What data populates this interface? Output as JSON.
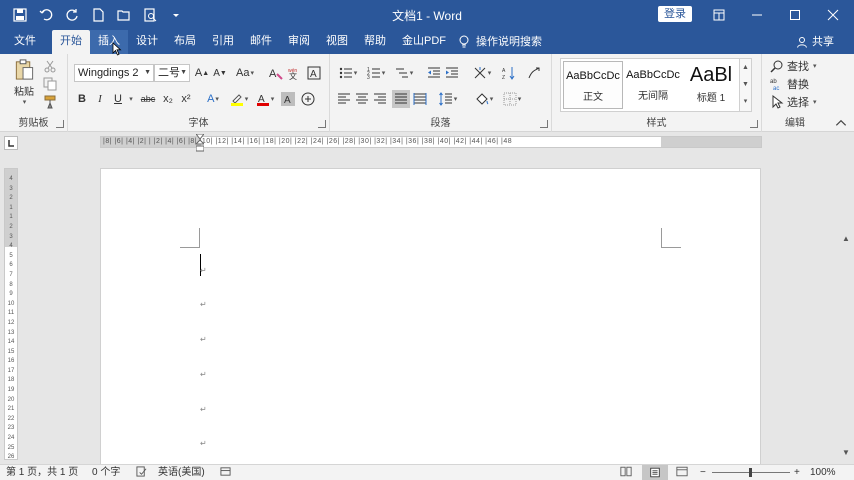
{
  "window": {
    "title": "文档1 - Word",
    "login_label": "登录"
  },
  "tabs": [
    {
      "label": "文件",
      "state": "normal"
    },
    {
      "label": "开始",
      "state": "active"
    },
    {
      "label": "插入",
      "state": "hover"
    },
    {
      "label": "设计",
      "state": "normal"
    },
    {
      "label": "布局",
      "state": "normal"
    },
    {
      "label": "引用",
      "state": "normal"
    },
    {
      "label": "邮件",
      "state": "normal"
    },
    {
      "label": "审阅",
      "state": "normal"
    },
    {
      "label": "视图",
      "state": "normal"
    },
    {
      "label": "帮助",
      "state": "normal"
    },
    {
      "label": "金山PDF",
      "state": "normal"
    }
  ],
  "tell_me": "操作说明搜索",
  "share": "共享",
  "ribbon": {
    "clipboard": {
      "label": "剪贴板",
      "paste_label": "粘贴"
    },
    "font": {
      "label": "字体",
      "font_name": "Wingdings 2",
      "font_size": "二号",
      "bold": "B",
      "italic": "I",
      "underline": "U",
      "strike": "abc",
      "subscript": "x₂",
      "superscript": "x²"
    },
    "paragraph": {
      "label": "段落"
    },
    "styles": {
      "label": "样式",
      "items": [
        {
          "sample": "AaBbCcDc",
          "name": "正文"
        },
        {
          "sample": "AaBbCcDc",
          "name": "无间隔"
        },
        {
          "sample": "AaBl",
          "name": "标题 1"
        }
      ]
    },
    "editing": {
      "label": "编辑",
      "find": "查找",
      "replace": "替换",
      "select": "选择"
    }
  },
  "ruler": {
    "horizontal_text": "|8| |6| |4| |2| | |2| |4| |6| |8| |10| |12| |14| |16| |18| |20| |22| |24| |26| |28| |30| |32| |34| |36| |38| |40| |42| |44| |46| |48",
    "vertical_numbers": [
      "4",
      "3",
      "2",
      "1",
      "",
      "1",
      "2",
      "3",
      "4",
      "5",
      "6",
      "7",
      "8",
      "9",
      "10",
      "11",
      "12",
      "13",
      "14",
      "15",
      "16",
      "17",
      "18",
      "19",
      "20",
      "21",
      "22",
      "23",
      "24",
      "25",
      "26"
    ]
  },
  "document": {
    "paragraph_mark": "↵"
  },
  "statusbar": {
    "page": "第 1 页，共 1 页",
    "words": "0 个字",
    "language": "英语(美国)",
    "zoom": "100%",
    "zoom_minus": "−",
    "zoom_plus": "+"
  },
  "colors": {
    "brand": "#2b579a",
    "highlight": "#ffff00",
    "font_color": "#e00000"
  }
}
